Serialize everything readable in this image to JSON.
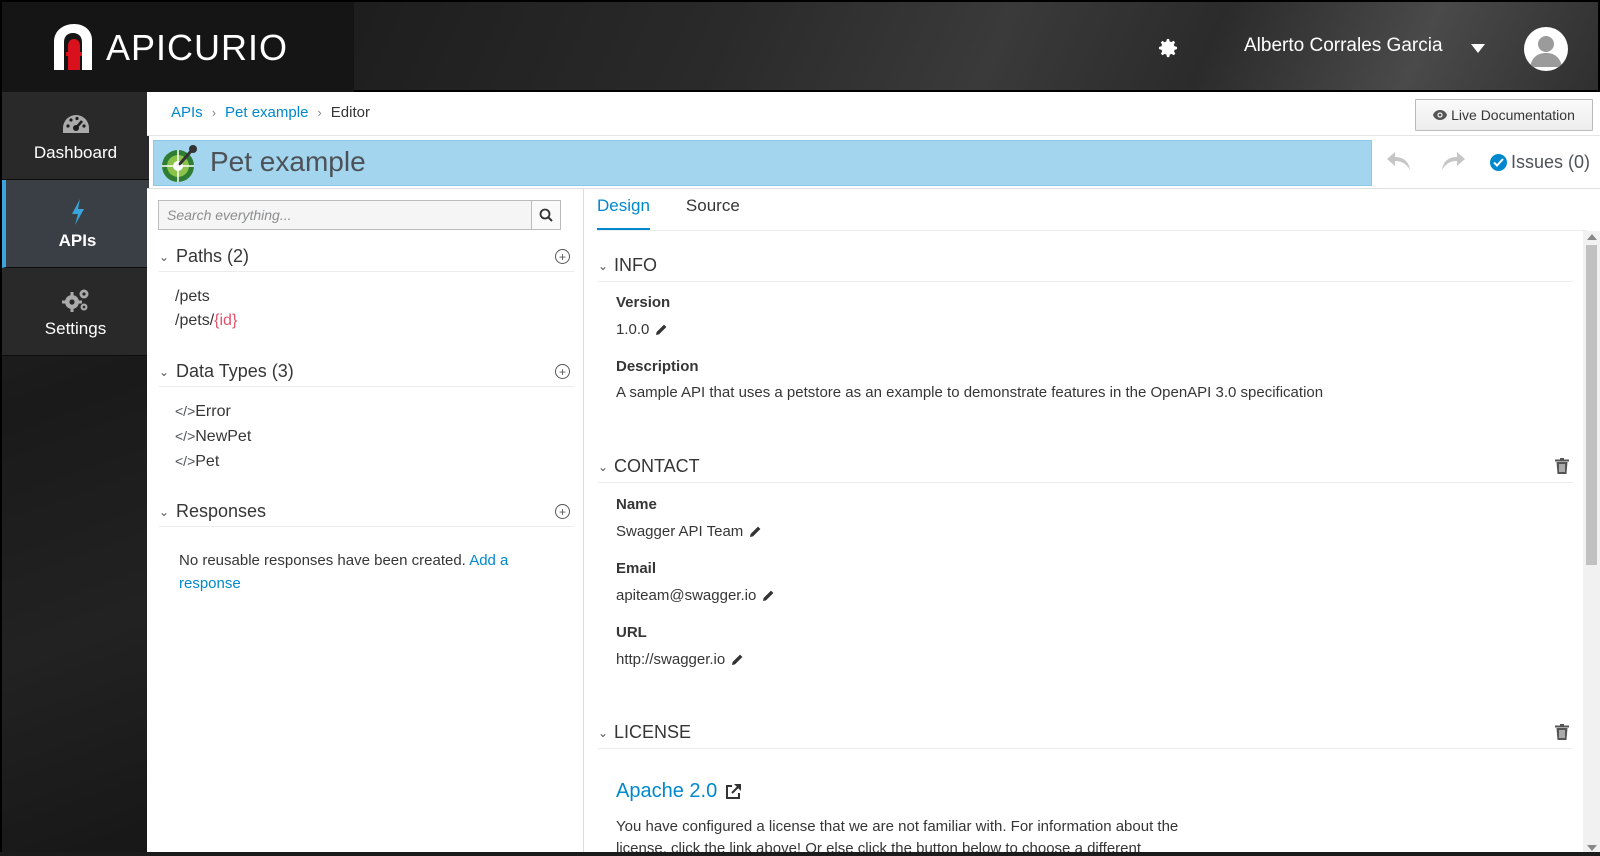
{
  "app": {
    "name": "APICURIO"
  },
  "header": {
    "user_name": "Alberto Corrales Garcia"
  },
  "nav": {
    "items": [
      {
        "label": "Dashboard",
        "icon": "dashboard-icon"
      },
      {
        "label": "APIs",
        "icon": "bolt-icon"
      },
      {
        "label": "Settings",
        "icon": "cogs-icon"
      }
    ]
  },
  "breadcrumb": {
    "items": [
      "APIs",
      "Pet example"
    ],
    "current": "Editor"
  },
  "toolbar": {
    "live_doc_label": "Live Documentation",
    "issues_label": "Issues (0)"
  },
  "editor": {
    "title": "Pet example"
  },
  "search": {
    "placeholder": "Search everything..."
  },
  "left": {
    "paths_heading": "Paths (2)",
    "paths": [
      {
        "prefix": "/pets",
        "param": ""
      },
      {
        "prefix": "/pets/",
        "param": "{id}"
      }
    ],
    "types_heading": "Data Types (3)",
    "types": [
      "Error",
      "NewPet",
      "Pet"
    ],
    "type_tag": "</>",
    "responses_heading": "Responses",
    "responses_empty": "No reusable responses have been created.",
    "responses_link": "Add a response"
  },
  "tabs": [
    "Design",
    "Source"
  ],
  "info": {
    "heading": "INFO",
    "version_label": "Version",
    "version": "1.0.0",
    "description_label": "Description",
    "description": "A sample API that uses a petstore as an example to demonstrate features in the OpenAPI 3.0 specification"
  },
  "contact": {
    "heading": "CONTACT",
    "name_label": "Name",
    "name": "Swagger API Team",
    "email_label": "Email",
    "email": "apiteam@swagger.io",
    "url_label": "URL",
    "url": "http://swagger.io"
  },
  "license": {
    "heading": "LICENSE",
    "name": "Apache 2.0",
    "note": "You have configured a license that we are not familiar with. For information about the license, click the link above! Or else click the button below to choose a different"
  },
  "colors": {
    "accent": "#0088ce",
    "title_bar": "#a3d5ee",
    "param": "#e3526a"
  }
}
